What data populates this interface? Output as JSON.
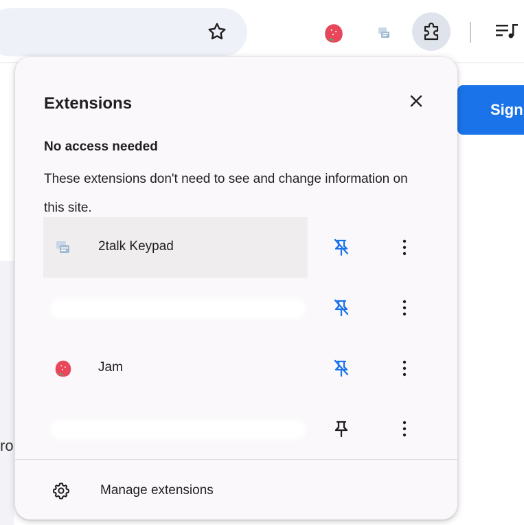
{
  "popup": {
    "title": "Extensions",
    "close_icon": "close-icon",
    "section_title": "No access needed",
    "section_description": "These extensions don't need to see and change information on this site.",
    "extensions": [
      {
        "name": "2talk Keypad",
        "icon": "2talk-icon",
        "pinned": true,
        "hovered": true
      },
      {
        "name": "",
        "icon": "",
        "pinned": true,
        "hovered": false
      },
      {
        "name": "Jam",
        "icon": "jam-icon",
        "pinned": true,
        "hovered": false
      },
      {
        "name": "",
        "icon": "",
        "pinned": false,
        "hovered": false
      }
    ],
    "manage_label": "Manage extensions"
  },
  "page": {
    "signin_label": "Sign",
    "partial_text": "ro"
  },
  "colors": {
    "accent": "#1a73e8",
    "pinned_icon": "#1a73e8",
    "popup_bg": "#fbf8fb",
    "jam_red": "#e8475b"
  }
}
